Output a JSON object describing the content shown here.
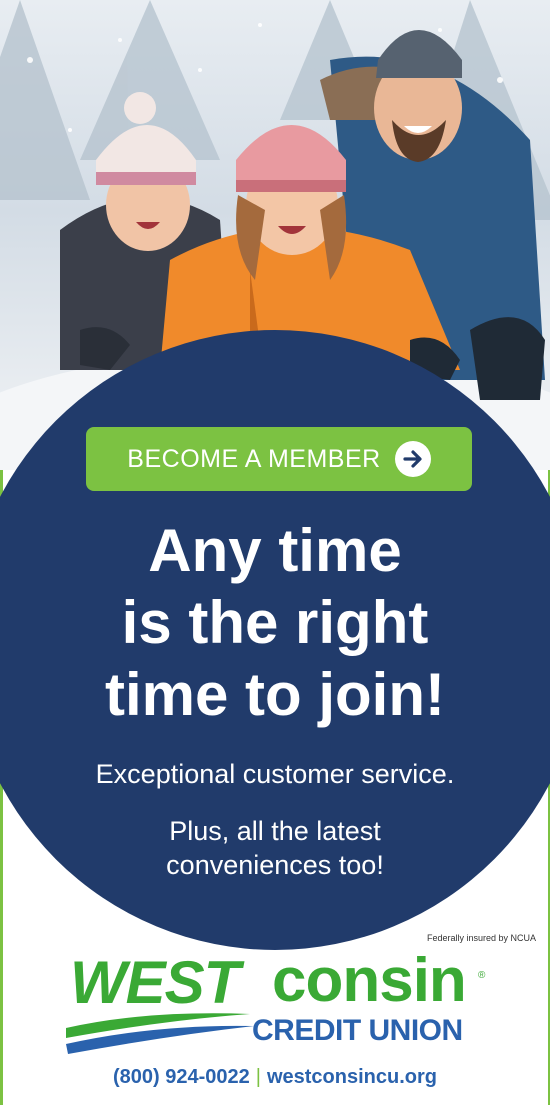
{
  "hero": {
    "image_description": ""
  },
  "cta": {
    "label": "BECOME A MEMBER",
    "icon": "arrow-right-icon"
  },
  "headline": {
    "line1": "Any time",
    "line2": "is the right",
    "line3": "time to join!"
  },
  "subline": "Exceptional customer service.",
  "subline2": {
    "line1": "Plus, all the latest",
    "line2": "conveniences too!"
  },
  "ncua_note": "Federally insured by NCUA",
  "logo": {
    "west": "WEST",
    "consin": "consin",
    "registered": "®",
    "credit_union": "CREDIT UNION"
  },
  "contact": {
    "phone": "(800) 924-0022",
    "separator": "|",
    "website": "westconsincu.org"
  },
  "colors": {
    "navy": "#213b6b",
    "green": "#7cc242",
    "logo_green": "#3aa935",
    "logo_blue": "#2a62ad"
  }
}
